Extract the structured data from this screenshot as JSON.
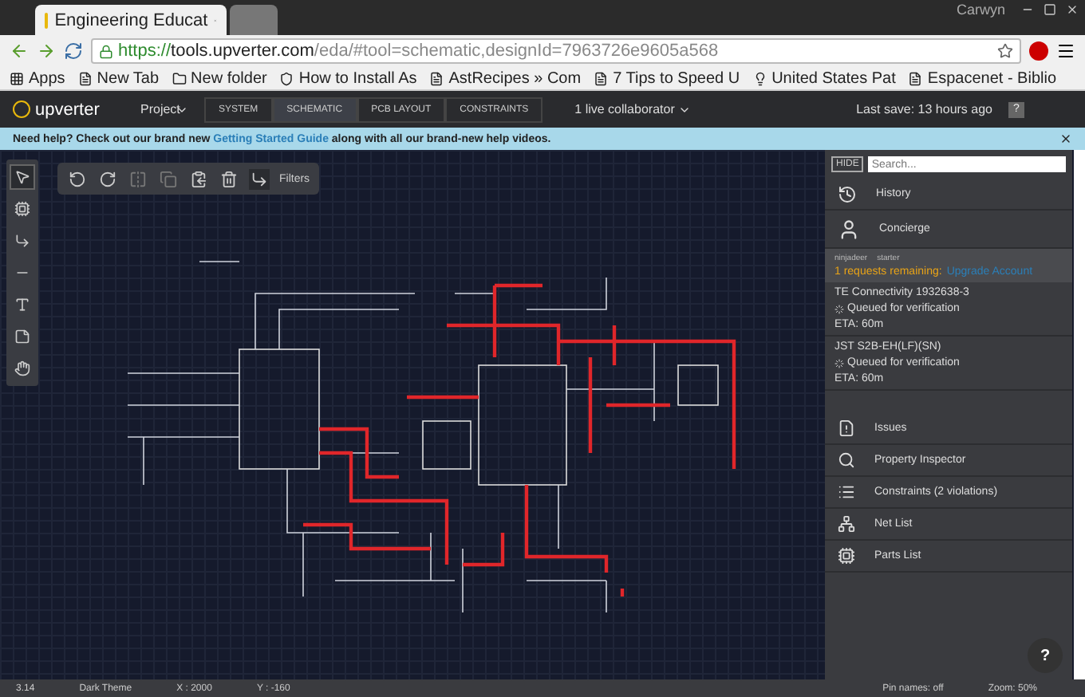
{
  "browser": {
    "user": "Carwyn",
    "tabs": [
      {
        "title": "Engineering Educat",
        "selected": true
      },
      {
        "selected": false
      }
    ],
    "url": {
      "scheme": "https://",
      "host": "tools.upverter.com",
      "path": "/eda/#tool=schematic,designId=7963726e9605a568"
    },
    "bookmarks": [
      {
        "label": "Apps",
        "kind": "apps"
      },
      {
        "label": "New Tab",
        "kind": "page"
      },
      {
        "label": "New folder",
        "kind": "folder"
      },
      {
        "label": "How to Install As",
        "kind": "shield"
      },
      {
        "label": "AstRecipes » Com",
        "kind": "script"
      },
      {
        "label": "7 Tips to Speed U",
        "kind": "page"
      },
      {
        "label": "United States Pat",
        "kind": "bulb"
      },
      {
        "label": "Espacenet - Biblio",
        "kind": "letter"
      }
    ]
  },
  "app": {
    "logo": "upverter",
    "project": "Project",
    "views": [
      {
        "label": "SYSTEM",
        "selected": false
      },
      {
        "label": "SCHEMATIC",
        "selected": true
      },
      {
        "label": "PCB LAYOUT",
        "selected": false
      },
      {
        "label": "CONSTRAINTS",
        "selected": false
      }
    ],
    "collaborators": "1 live collaborator",
    "last_save": "Last save: 13 hours ago",
    "help": "?"
  },
  "banner": {
    "text": "Need help? Check out our brand new ",
    "link": "Getting Started Guide",
    "rest": " along with all our brand-new help videos."
  },
  "toolbar": {
    "tools": [
      {
        "kind": "select",
        "selected": true
      },
      {
        "kind": "chip",
        "selected": false
      },
      {
        "kind": "wire",
        "selected": false
      },
      {
        "kind": "ground",
        "selected": false
      },
      {
        "kind": "text",
        "selected": false
      },
      {
        "kind": "note",
        "selected": false
      },
      {
        "kind": "hand",
        "selected": false
      }
    ],
    "actions": [
      {
        "kind": "rotate-left",
        "disabled": false
      },
      {
        "kind": "rotate-right",
        "disabled": false
      },
      {
        "kind": "flip",
        "disabled": true
      },
      {
        "kind": "copy",
        "disabled": true
      },
      {
        "kind": "paste",
        "disabled": false
      },
      {
        "kind": "delete",
        "disabled": false
      },
      {
        "kind": "wire",
        "disabled": false
      }
    ],
    "filters": "Filters"
  },
  "panel": {
    "hide": "HIDE",
    "search": {
      "placeholder": "Search..."
    },
    "history": "History",
    "concierge": {
      "title": "Concierge",
      "user": "ninjadeer",
      "plan": "starter",
      "requests": "1 requests remaining:",
      "upgrade": "Upgrade Account",
      "items": [
        {
          "name": "TE Connectivity 1932638-3",
          "status": "Queued for verification",
          "eta": "ETA: 60m"
        },
        {
          "name": "JST S2B-EH(LF)(SN)",
          "status": "Queued for verification",
          "eta": "ETA: 60m"
        }
      ]
    },
    "menu": [
      {
        "label": "Issues",
        "kind": "issues"
      },
      {
        "label": "Property Inspector",
        "kind": "inspector"
      },
      {
        "label": "Constraints (2 violations)",
        "kind": "constraints"
      },
      {
        "label": "Net List",
        "kind": "netlist"
      },
      {
        "label": "Parts List",
        "kind": "parts"
      }
    ],
    "chat": "?"
  },
  "status_bar": {
    "version": "3.14",
    "theme": "Dark Theme",
    "x": "X : 2000",
    "y": "Y : -160",
    "pin_names": "Pin names: off",
    "zoom": "Zoom: 50%"
  }
}
